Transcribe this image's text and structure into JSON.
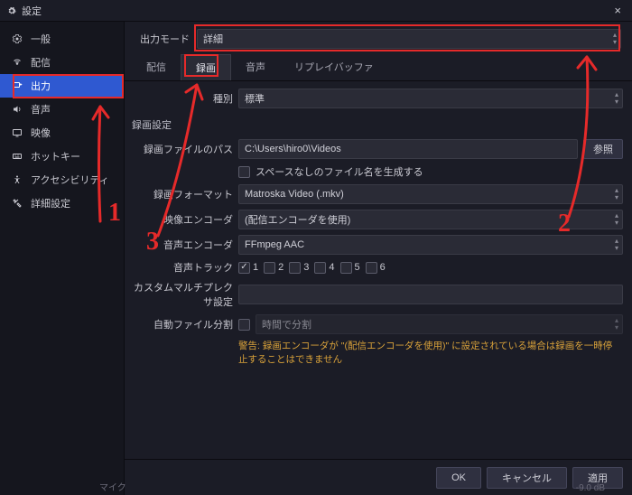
{
  "title": "設定",
  "close_glyph": "×",
  "sidebar": {
    "items": [
      {
        "label": "一般"
      },
      {
        "label": "配信"
      },
      {
        "label": "出力"
      },
      {
        "label": "音声"
      },
      {
        "label": "映像"
      },
      {
        "label": "ホットキー"
      },
      {
        "label": "アクセシビリティ"
      },
      {
        "label": "詳細設定"
      }
    ]
  },
  "mode": {
    "label": "出力モード",
    "value": "詳細"
  },
  "tabs": [
    {
      "label": "配信"
    },
    {
      "label": "録画"
    },
    {
      "label": "音声"
    },
    {
      "label": "リプレイバッファ"
    }
  ],
  "type_row": {
    "label": "種別",
    "value": "標準"
  },
  "section_title": "録画設定",
  "path_row": {
    "label": "録画ファイルのパス",
    "value": "C:\\Users\\hiro0\\Videos",
    "browse": "参照"
  },
  "nospace": {
    "label": "スペースなしのファイル名を生成する"
  },
  "format_row": {
    "label": "録画フォーマット",
    "value": "Matroska Video (.mkv)"
  },
  "venc_row": {
    "label": "映像エンコーダ",
    "value": "(配信エンコーダを使用)"
  },
  "aenc_row": {
    "label": "音声エンコーダ",
    "value": "FFmpeg AAC"
  },
  "tracks_row": {
    "label": "音声トラック",
    "items": [
      "1",
      "2",
      "3",
      "4",
      "5",
      "6"
    ]
  },
  "mux_row": {
    "label": "カスタムマルチプレクサ設定"
  },
  "split_row": {
    "label": "自動ファイル分割",
    "value": "時間で分割"
  },
  "warning": "警告: 録画エンコーダが \"(配信エンコーダを使用)\" に設定されている場合は録画を一時停止することはできません",
  "buttons": {
    "ok": "OK",
    "cancel": "キャンセル",
    "apply": "適用"
  },
  "annotations": {
    "n1": "1",
    "n2": "2",
    "n3": "3"
  },
  "status": {
    "mic": "マイク",
    "db": "-9.0 dB"
  }
}
